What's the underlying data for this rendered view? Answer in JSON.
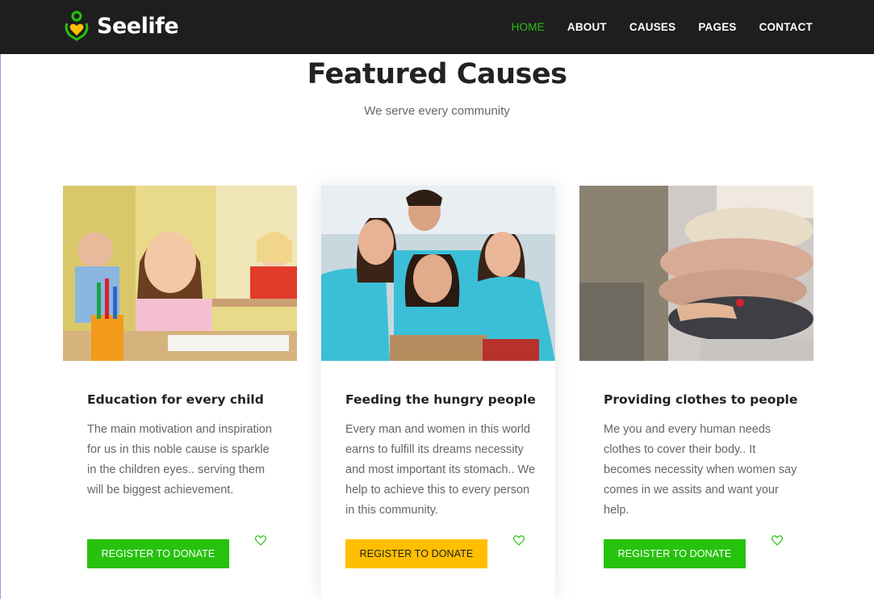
{
  "brand": {
    "name": "Seelife",
    "logo_icon": "heart-person-icon",
    "accent_color": "#27c20e",
    "highlight_color": "#ffbf00"
  },
  "nav": {
    "items": [
      "HOME",
      "ABOUT",
      "CAUSES",
      "PAGES",
      "CONTACT"
    ],
    "active": "HOME"
  },
  "section": {
    "title": "Featured Causes",
    "subtitle": "We serve every community"
  },
  "causes": [
    {
      "image": "girl-at-desk-photo",
      "title": "Education for every child",
      "text": "The main motivation and inspiration for us in this noble cause is sparkle in the children eyes.. serving them will be biggest achievement.",
      "button": "REGISTER TO DONATE",
      "button_color": "#27c20e",
      "icon": "heart-outline-icon"
    },
    {
      "image": "volunteers-group-photo",
      "title": "Feeding the hungry people",
      "text": "Every man and women in this world earns to fulfill its dreams necessity and most important its stomach.. We help to achieve this to every person in this community.",
      "button": "REGISTER TO DONATE",
      "button_color": "#ffbf00",
      "icon": "heart-outline-icon"
    },
    {
      "image": "folded-sweaters-photo",
      "title": "Providing clothes to people",
      "text": "Me you and every human needs clothes to cover their body.. It becomes necessity when women say comes in we assits and want your help.",
      "button": "REGISTER TO DONATE",
      "button_color": "#27c20e",
      "icon": "heart-outline-icon"
    }
  ]
}
